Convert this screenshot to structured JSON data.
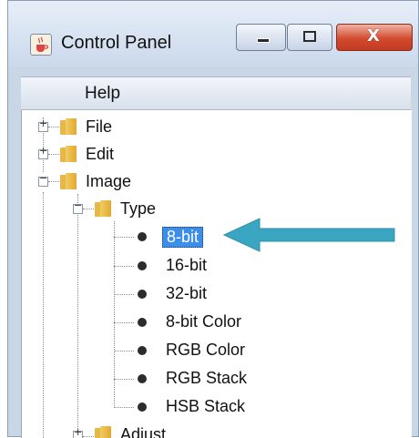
{
  "window": {
    "title": "Control Panel",
    "buttons": {
      "minimize": "minimize",
      "maximize": "maximize",
      "close": "X"
    }
  },
  "menu": {
    "help": "Help"
  },
  "tree": {
    "file": "File",
    "edit": "Edit",
    "image": "Image",
    "type": "Type",
    "items": [
      "8-bit",
      "16-bit",
      "32-bit",
      "8-bit Color",
      "RGB Color",
      "RGB Stack",
      "HSB Stack"
    ],
    "selected": "8-bit",
    "adjust": "Adjust"
  },
  "colors": {
    "selection": "#3d8ee8",
    "arrow": "#3aa6c2",
    "folder": "#e6b84a"
  },
  "icons": {
    "app": "java-cup-icon",
    "expand": "plus-icon",
    "collapse": "minus-icon",
    "leaf": "bullet-icon",
    "callout": "arrow-left-icon"
  }
}
